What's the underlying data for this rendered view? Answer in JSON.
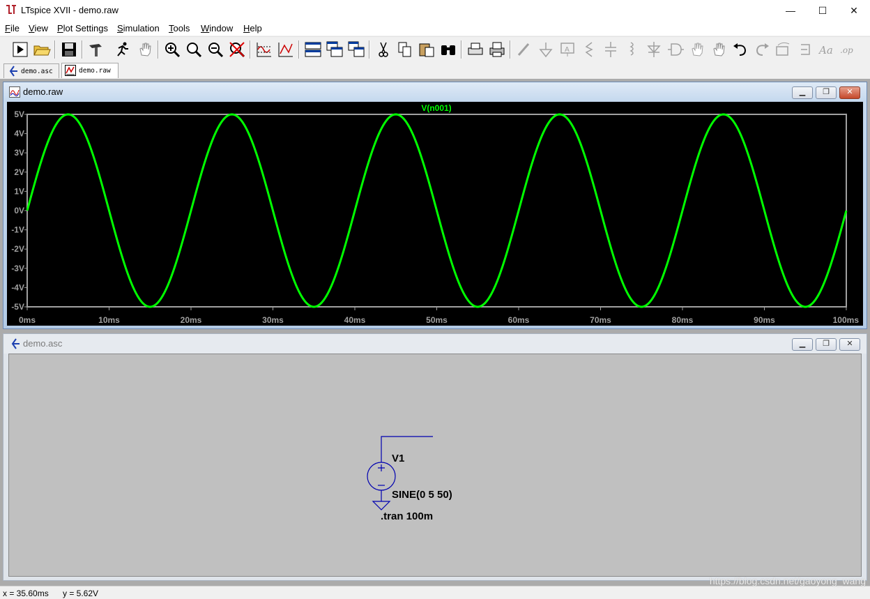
{
  "window": {
    "title": "LTspice XVII - demo.raw",
    "minimize_glyph": "—",
    "maximize_glyph": "☐",
    "close_glyph": "✕"
  },
  "menu": [
    {
      "first": "F",
      "rest": "ile"
    },
    {
      "first": "V",
      "rest": "iew"
    },
    {
      "first": "P",
      "rest": "lot Settings"
    },
    {
      "first": "S",
      "rest": "imulation"
    },
    {
      "first": "T",
      "rest": "ools"
    },
    {
      "first": "W",
      "rest": "indow"
    },
    {
      "first": "H",
      "rest": "elp"
    }
  ],
  "toolbar_icons": [
    "run-icon",
    "open-icon",
    "save-icon",
    "hammer-icon",
    "running-man-icon",
    "hand-pan-icon",
    "zoom-in-icon",
    "zoom-to-fit-icon",
    "zoom-out-icon",
    "zoom-cancel-icon",
    "autorange-icon",
    "pick-visible-icon",
    "tile-horizontal-icon",
    "cascade-icon",
    "tile-vertical-icon",
    "cut-icon",
    "copy-icon",
    "paste-icon",
    "find-icon",
    "print-preview-icon",
    "print-icon",
    "wire-icon",
    "ground-icon",
    "label-net-icon",
    "resistor-icon",
    "capacitor-icon",
    "inductor-icon",
    "diode-icon",
    "component-icon",
    "move-icon",
    "drag-icon",
    "undo-icon",
    "redo-icon",
    "rotate-icon",
    "mirror-icon",
    "text-icon",
    "spice-directive-icon"
  ],
  "tabs": [
    {
      "label": "demo.asc"
    },
    {
      "label": "demo.raw"
    }
  ],
  "plot_window": {
    "title": "demo.raw",
    "trace_label": "V(n001)",
    "trace_color": "#00ff00",
    "background": "#000000"
  },
  "schematic_window": {
    "title": "demo.asc",
    "component_name": "V1",
    "component_value": "SINE(0 5 50)",
    "directive": ".tran 100m"
  },
  "chart_data": {
    "type": "line",
    "title": "V(n001)",
    "xlabel": "",
    "ylabel": "",
    "xlim": [
      0,
      100
    ],
    "ylim": [
      -5,
      5
    ],
    "x_unit": "ms",
    "y_unit": "V",
    "x_ticks": [
      "0ms",
      "10ms",
      "20ms",
      "30ms",
      "40ms",
      "50ms",
      "60ms",
      "70ms",
      "80ms",
      "90ms",
      "100ms"
    ],
    "y_ticks": [
      "5V",
      "4V",
      "3V",
      "2V",
      "1V",
      "0V",
      "-1V",
      "-2V",
      "-3V",
      "-4V",
      "-5V"
    ],
    "grid": false,
    "series": [
      {
        "name": "V(n001)",
        "color": "#00ff00",
        "amplitude": 5,
        "frequency_hz": 50,
        "offset": 0,
        "x": [
          0,
          5,
          10,
          15,
          20,
          25,
          30,
          35,
          40,
          45,
          50,
          55,
          60,
          65,
          70,
          75,
          80,
          85,
          90,
          95,
          100
        ],
        "y": [
          0,
          5,
          0,
          -5,
          0,
          5,
          0,
          -5,
          0,
          5,
          0,
          -5,
          0,
          5,
          0,
          -5,
          0,
          5,
          0,
          -5,
          0
        ]
      }
    ]
  },
  "status": {
    "x_readout": "x = 35.60ms",
    "y_readout": "y = 5.62V",
    "watermark": "https://blog.csdn.net/gaoyong_wang"
  }
}
